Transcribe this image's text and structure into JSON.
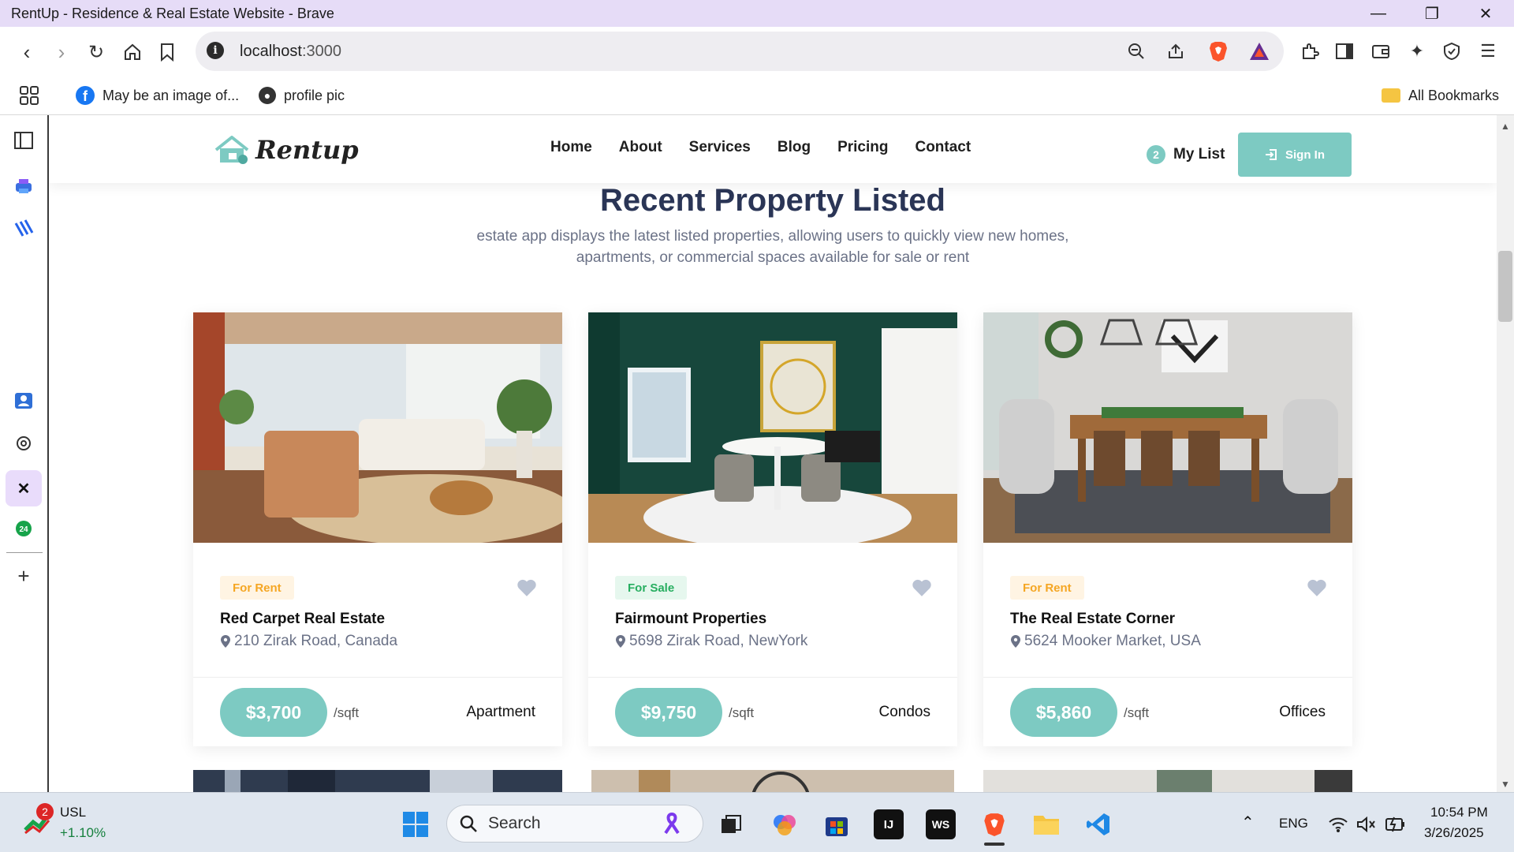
{
  "browser": {
    "window_title": "RentUp - Residence & Real Estate Website - Brave",
    "url_host": "localhost",
    "url_port": ":3000"
  },
  "bookmarks": {
    "items": [
      {
        "label": "May be an image of...",
        "icon": "facebook-icon"
      },
      {
        "label": "profile pic",
        "icon": "globe-icon"
      }
    ],
    "all_label": "All Bookmarks"
  },
  "site": {
    "logo_text": "Rentup",
    "nav": [
      "Home",
      "About",
      "Services",
      "Blog",
      "Pricing",
      "Contact"
    ],
    "mylist_count": "2",
    "mylist_label": "My List",
    "signin_label": "Sign In"
  },
  "section": {
    "title": "Recent Property Listed",
    "subtitle": "estate app displays the latest listed properties, allowing users to quickly view new homes, apartments, or commercial spaces available for sale or rent"
  },
  "cards": [
    {
      "tag": "For Rent",
      "tag_color": "#f5a623",
      "tag_bg": "#fff4e3",
      "name": "Red Carpet Real Estate",
      "address": "210 Zirak Road, Canada",
      "price": "$3,700",
      "unit": "/sqft",
      "type": "Apartment"
    },
    {
      "tag": "For Sale",
      "tag_color": "#27ae60",
      "tag_bg": "#e6f7ee",
      "name": "Fairmount Properties",
      "address": "5698 Zirak Road, NewYork",
      "price": "$9,750",
      "unit": "/sqft",
      "type": "Condos"
    },
    {
      "tag": "For Rent",
      "tag_color": "#f5a623",
      "tag_bg": "#fff4e3",
      "name": "The Real Estate Corner",
      "address": "5624 Mooker Market, USA",
      "price": "$5,860",
      "unit": "/sqft",
      "type": "Offices"
    }
  ],
  "colors": {
    "accent": "#7dcac2",
    "heading": "#2a3556",
    "muted": "#6b7287"
  },
  "taskbar": {
    "stock_badge": "2",
    "stock_name": "USL",
    "stock_change": "+1.10%",
    "search_placeholder": "Search",
    "lang": "ENG",
    "time": "10:54 PM",
    "date": "3/26/2025"
  }
}
